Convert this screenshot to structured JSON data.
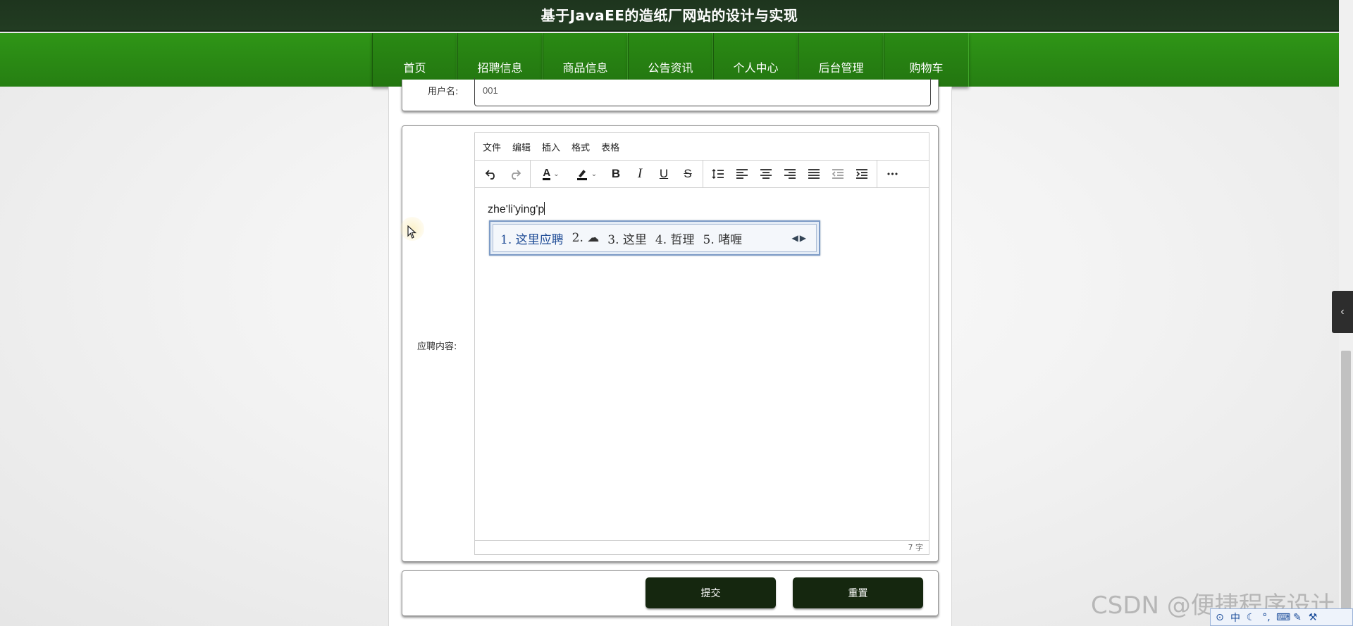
{
  "site": {
    "title": "基于JavaEE的造纸厂网站的设计与实现"
  },
  "nav": {
    "items": [
      {
        "label": "首页"
      },
      {
        "label": "招聘信息"
      },
      {
        "label": "商品信息"
      },
      {
        "label": "公告资讯"
      },
      {
        "label": "个人中心"
      },
      {
        "label": "后台管理"
      },
      {
        "label": "购物车"
      }
    ]
  },
  "form": {
    "username": {
      "label": "用户名:",
      "value": "001"
    },
    "content": {
      "label": "应聘内容:"
    },
    "submit_label": "提交",
    "reset_label": "重置"
  },
  "editor": {
    "menus": [
      {
        "label": "文件"
      },
      {
        "label": "编辑"
      },
      {
        "label": "插入"
      },
      {
        "label": "格式"
      },
      {
        "label": "表格"
      }
    ],
    "toolbar": {
      "bold": "B",
      "italic": "I",
      "underline": "U",
      "strike": "S",
      "font_color": "A",
      "more": "•••"
    },
    "typed_text": "zhe'li'ying'p",
    "word_count": "7 字"
  },
  "ime": {
    "candidates": [
      {
        "label": "1. 这里应聘"
      },
      {
        "label": "2. ☁"
      },
      {
        "label": "3. 这里"
      },
      {
        "label": "4. 哲理"
      },
      {
        "label": "5. 啫喱"
      }
    ],
    "tray_mode": "中"
  },
  "watermark": "CSDN @便捷程序设计",
  "colors": {
    "header_bg": "#223c22",
    "nav_bg": "#2f9517",
    "button_bg": "#15270f",
    "ime_selected": "#1f4c96"
  }
}
